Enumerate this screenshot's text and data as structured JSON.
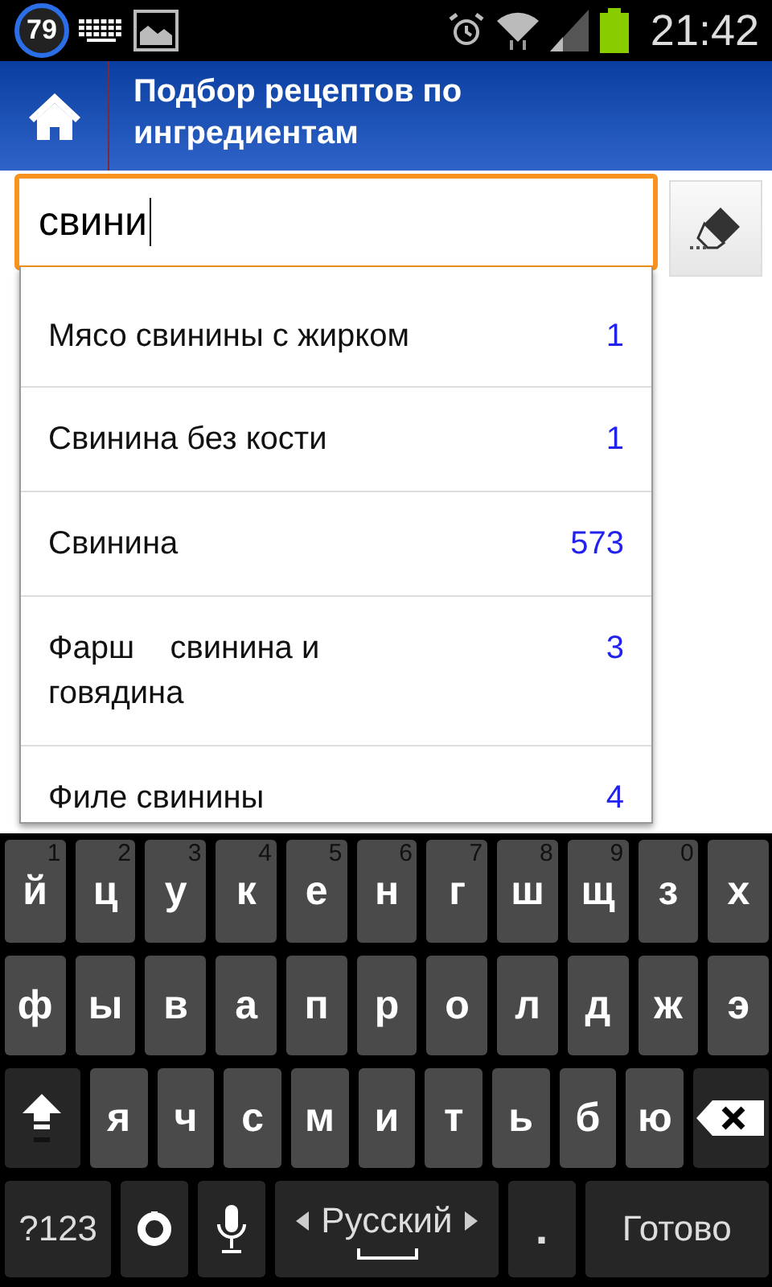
{
  "status_bar": {
    "badge": "79",
    "time": "21:42"
  },
  "header": {
    "title": "Подбор рецептов по ингредиентам"
  },
  "search": {
    "value": "свини",
    "focused": true
  },
  "suggestions": [
    {
      "name": "Мясо свинины с жирком",
      "count": "1"
    },
    {
      "name": "Свинина без кости",
      "count": "1"
    },
    {
      "name": "Свинина",
      "count": "573"
    },
    {
      "name": "Фарш    свинина и говядина",
      "count": "3"
    },
    {
      "name": "Филе свинины",
      "count": "4"
    }
  ],
  "keyboard": {
    "letter_rows": [
      [
        {
          "kind": "letter",
          "label": "й",
          "hint": "1"
        },
        {
          "kind": "letter",
          "label": "ц",
          "hint": "2"
        },
        {
          "kind": "letter",
          "label": "у",
          "hint": "3"
        },
        {
          "kind": "letter",
          "label": "к",
          "hint": "4"
        },
        {
          "kind": "letter",
          "label": "е",
          "hint": "5"
        },
        {
          "kind": "letter",
          "label": "н",
          "hint": "6"
        },
        {
          "kind": "letter",
          "label": "г",
          "hint": "7"
        },
        {
          "kind": "letter",
          "label": "ш",
          "hint": "8"
        },
        {
          "kind": "letter",
          "label": "щ",
          "hint": "9"
        },
        {
          "kind": "letter",
          "label": "з",
          "hint": "0"
        },
        {
          "kind": "letter",
          "label": "х"
        }
      ],
      [
        {
          "kind": "letter",
          "label": "ф"
        },
        {
          "kind": "letter",
          "label": "ы"
        },
        {
          "kind": "letter",
          "label": "в"
        },
        {
          "kind": "letter",
          "label": "а"
        },
        {
          "kind": "letter",
          "label": "п"
        },
        {
          "kind": "letter",
          "label": "р"
        },
        {
          "kind": "letter",
          "label": "о"
        },
        {
          "kind": "letter",
          "label": "л"
        },
        {
          "kind": "letter",
          "label": "д"
        },
        {
          "kind": "letter",
          "label": "ж"
        },
        {
          "kind": "letter",
          "label": "э"
        }
      ],
      [
        {
          "kind": "shift"
        },
        {
          "kind": "letter",
          "label": "я"
        },
        {
          "kind": "letter",
          "label": "ч"
        },
        {
          "kind": "letter",
          "label": "с"
        },
        {
          "kind": "letter",
          "label": "м"
        },
        {
          "kind": "letter",
          "label": "и"
        },
        {
          "kind": "letter",
          "label": "т"
        },
        {
          "kind": "letter",
          "label": "ь"
        },
        {
          "kind": "letter",
          "label": "б"
        },
        {
          "kind": "letter",
          "label": "ю"
        },
        {
          "kind": "backspace"
        }
      ]
    ],
    "bottom_row": [
      {
        "kind": "symbols",
        "label": "?123"
      },
      {
        "kind": "settings"
      },
      {
        "kind": "mic"
      },
      {
        "kind": "space",
        "label": "Русский"
      },
      {
        "kind": "period",
        "label": "."
      },
      {
        "kind": "done",
        "label": "Готово"
      }
    ]
  }
}
